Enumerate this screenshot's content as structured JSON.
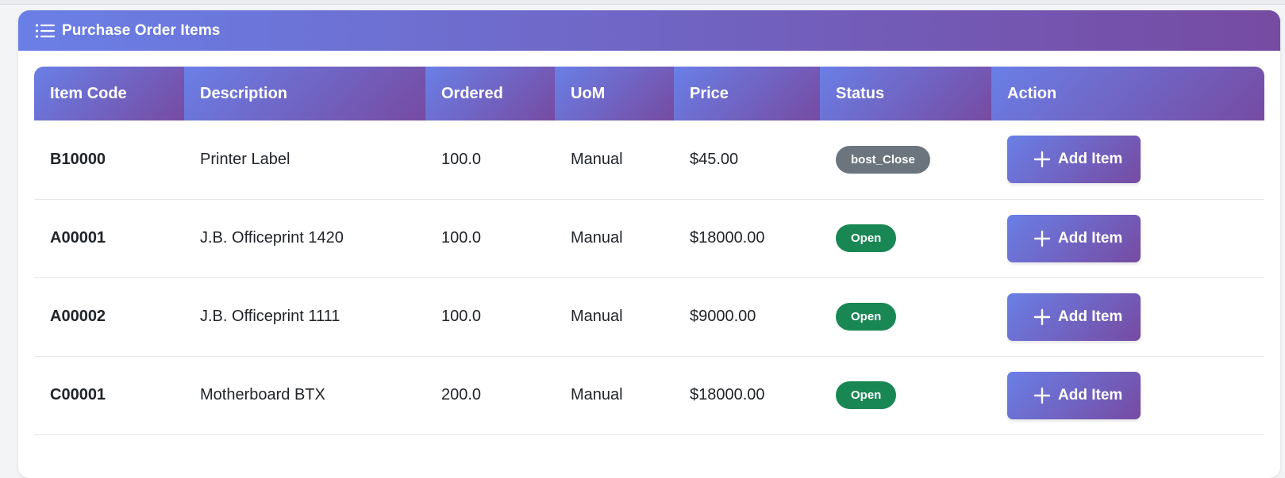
{
  "colors": {
    "header_gradient_start": "#6a7fe6",
    "header_gradient_end": "#764ba2",
    "status_closed": "#6c757d",
    "status_open": "#198754"
  },
  "card": {
    "title": "Purchase Order Items",
    "icon": "list-icon"
  },
  "table": {
    "columns": [
      "Item Code",
      "Description",
      "Ordered",
      "UoM",
      "Price",
      "Status",
      "Action"
    ],
    "rows": [
      {
        "code": "B10000",
        "description": "Printer Label",
        "ordered": "100.0",
        "uom": "Manual",
        "price": "$45.00",
        "status": "bost_Close",
        "status_color": "#6c757d",
        "action": "Add Item"
      },
      {
        "code": "A00001",
        "description": "J.B. Officeprint 1420",
        "ordered": "100.0",
        "uom": "Manual",
        "price": "$18000.00",
        "status": "Open",
        "status_color": "#198754",
        "action": "Add Item"
      },
      {
        "code": "A00002",
        "description": "J.B. Officeprint 1111",
        "ordered": "100.0",
        "uom": "Manual",
        "price": "$9000.00",
        "status": "Open",
        "status_color": "#198754",
        "action": "Add Item"
      },
      {
        "code": "C00001",
        "description": "Motherboard BTX",
        "ordered": "200.0",
        "uom": "Manual",
        "price": "$18000.00",
        "status": "Open",
        "status_color": "#198754",
        "action": "Add Item"
      }
    ],
    "action_icon": "plus-icon"
  }
}
